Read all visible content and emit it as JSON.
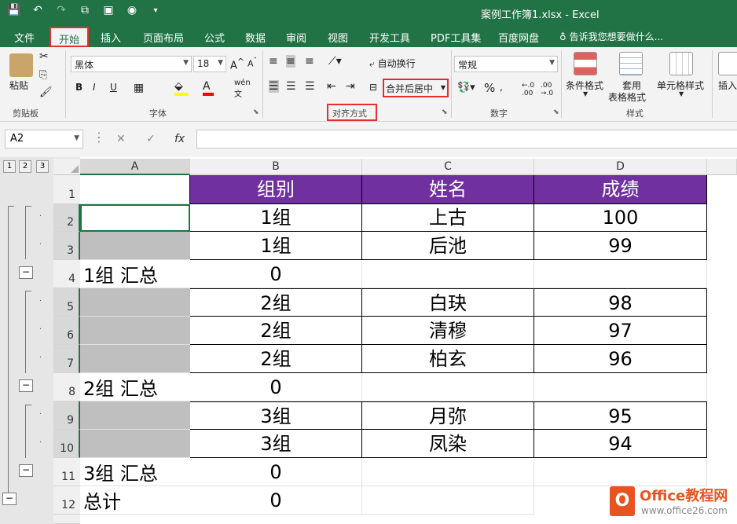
{
  "titlebar": {
    "title": "案例工作簿1.xlsx - Excel",
    "qat_icons": [
      "save-icon",
      "undo-icon",
      "redo-icon",
      "screenshot-icon",
      "picture-icon",
      "camera-icon",
      "customize-qat-icon"
    ]
  },
  "tabs": [
    "文件",
    "开始",
    "插入",
    "页面布局",
    "公式",
    "数据",
    "审阅",
    "视图",
    "开发工具",
    "PDF工具集",
    "百度网盘"
  ],
  "active_tab": "开始",
  "tell_me": "告诉我您想要做什么...",
  "ribbon": {
    "clipboard": {
      "paste": "粘贴",
      "label": "剪贴板"
    },
    "font": {
      "name": "黑体",
      "size": "18",
      "bold": "B",
      "italic": "I",
      "underline": "U",
      "label": "字体",
      "wen": "wén"
    },
    "alignment": {
      "wrap": "自动换行",
      "merge": "合并后居中",
      "label": "对齐方式"
    },
    "number": {
      "format": "常规",
      "percent": "%",
      "label": "数字"
    },
    "styles": {
      "conditional": "条件格式",
      "table_1": "套用",
      "table_2": "表格格式",
      "cell_styles": "单元格样式",
      "label": "样式"
    },
    "insert": "插入"
  },
  "formula_bar": {
    "name_box": "A2",
    "fx": "fx",
    "value": ""
  },
  "outline_levels": [
    "1",
    "2",
    "3"
  ],
  "columns": [
    "A",
    "B",
    "C",
    "D"
  ],
  "table": {
    "header": [
      "组别",
      "姓名",
      "成绩"
    ],
    "rows": [
      {
        "row": "1",
        "a": "",
        "b": "组别",
        "c": "姓名",
        "d": "成绩"
      },
      {
        "row": "2",
        "a": "",
        "b": "1组",
        "c": "上古",
        "d": "100"
      },
      {
        "row": "3",
        "a": "",
        "b": "1组",
        "c": "后池",
        "d": "99"
      },
      {
        "row": "4",
        "a": "1组 汇总",
        "b": "0",
        "c": "",
        "d": ""
      },
      {
        "row": "5",
        "a": "",
        "b": "2组",
        "c": "白玦",
        "d": "98"
      },
      {
        "row": "6",
        "a": "",
        "b": "2组",
        "c": "清穆",
        "d": "97"
      },
      {
        "row": "7",
        "a": "",
        "b": "2组",
        "c": "柏玄",
        "d": "96"
      },
      {
        "row": "8",
        "a": "2组 汇总",
        "b": "0",
        "c": "",
        "d": ""
      },
      {
        "row": "9",
        "a": "",
        "b": "3组",
        "c": "月弥",
        "d": "95"
      },
      {
        "row": "10",
        "a": "",
        "b": "3组",
        "c": "凤染",
        "d": "94"
      },
      {
        "row": "11",
        "a": "3组 汇总",
        "b": "0",
        "c": "",
        "d": ""
      },
      {
        "row": "12",
        "a": "总计",
        "b": "0",
        "c": "",
        "d": ""
      }
    ]
  },
  "watermark": {
    "brand": "Office教程网",
    "url": "www.office26.com"
  },
  "colors": {
    "excel_green": "#217346",
    "header_purple": "#7030a0",
    "highlight_red": "#e03030",
    "grey_fill": "#bfbfbf"
  }
}
